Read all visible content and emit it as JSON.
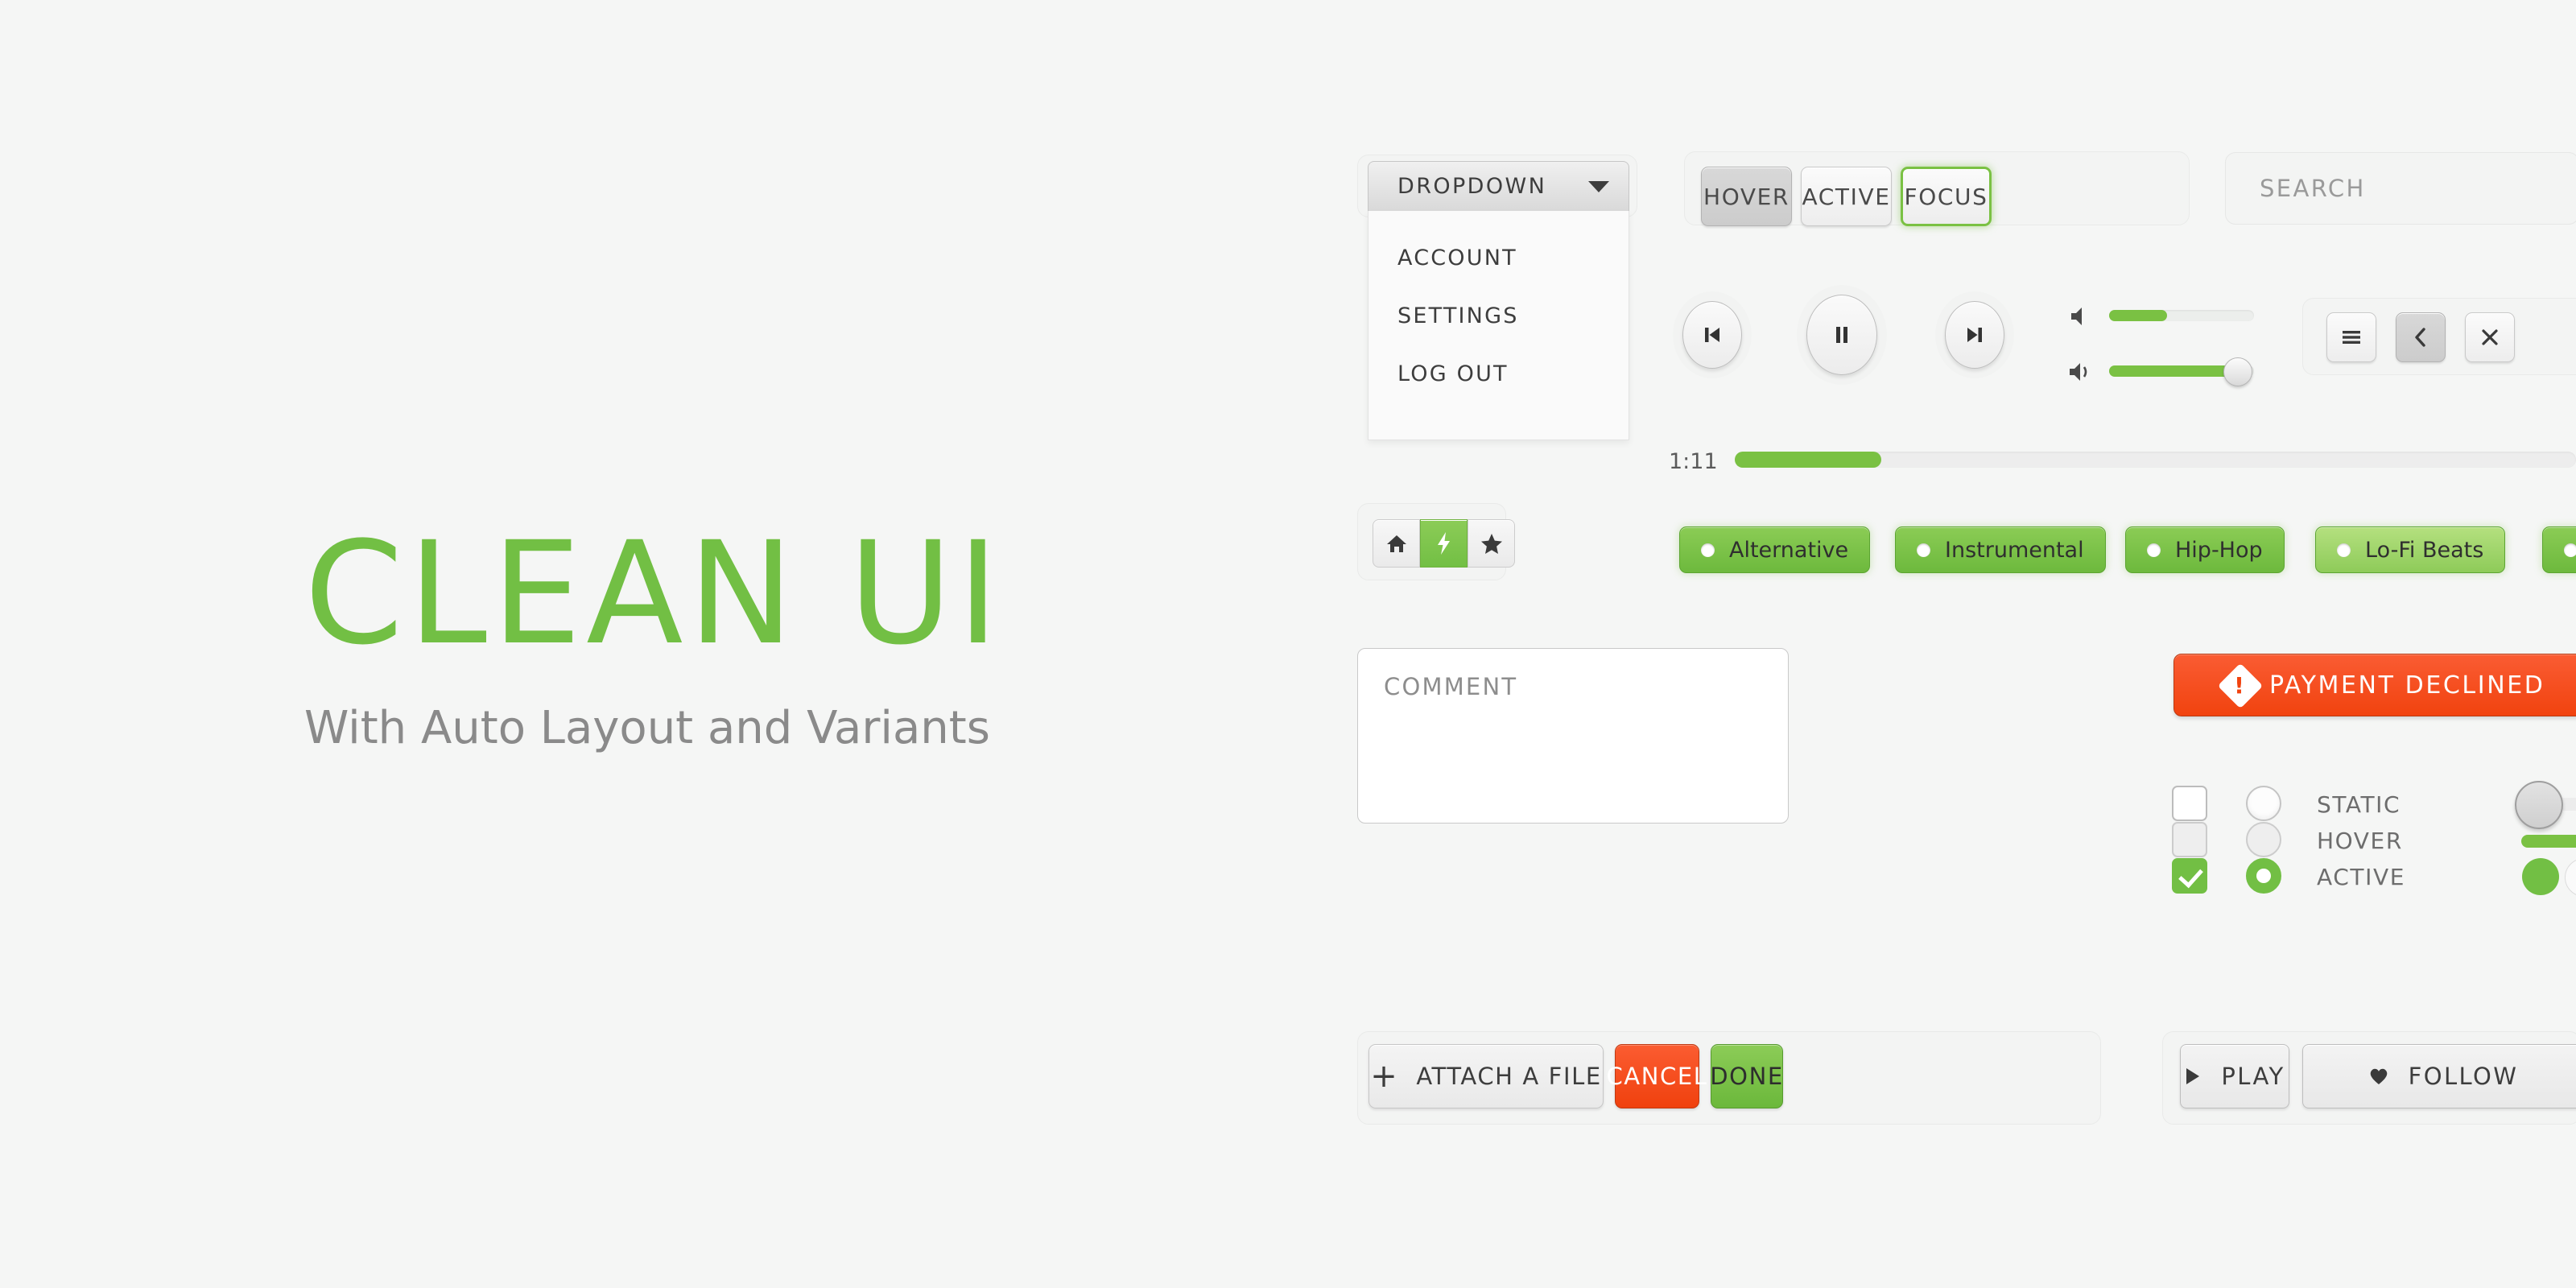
{
  "hero": {
    "title": "CLEAN UI",
    "subtitle": "With Auto Layout and Variants",
    "accent_color": "#72bf44",
    "subtitle_color": "#8a8a8a"
  },
  "dropdown": {
    "label": "DROPDOWN",
    "caret_icon": "chevron-down-icon",
    "items": [
      {
        "label": "ACCOUNT"
      },
      {
        "label": "SETTINGS"
      },
      {
        "label": "LOG OUT"
      }
    ]
  },
  "state_buttons": [
    {
      "label": "HOVER",
      "state": "hover"
    },
    {
      "label": "ACTIVE",
      "state": "active"
    },
    {
      "label": "FOCUS",
      "state": "focus"
    }
  ],
  "search": {
    "placeholder": "SEARCH",
    "value": ""
  },
  "player": {
    "transport": [
      {
        "name": "previous-track-button",
        "icon": "skip-back-icon"
      },
      {
        "name": "play-pause-button",
        "icon": "pause-icon"
      },
      {
        "name": "next-track-button",
        "icon": "skip-forward-icon"
      }
    ],
    "volume_sliders": [
      {
        "name": "volume-slider-low",
        "icon": "speaker-muted-icon",
        "percent": 40
      },
      {
        "name": "volume-slider-high",
        "icon": "speaker-on-icon",
        "percent": 88
      }
    ],
    "progress": {
      "time": "1:11",
      "percent": 17
    }
  },
  "icon_buttons": [
    {
      "name": "menu-button",
      "icon": "hamburger-icon",
      "state": "static"
    },
    {
      "name": "back-button",
      "icon": "chevron-left-icon",
      "state": "hover"
    },
    {
      "name": "close-button",
      "icon": "close-icon",
      "state": "static"
    }
  ],
  "icon_toggle_group": [
    {
      "name": "home-toggle",
      "icon": "home-icon",
      "active": false
    },
    {
      "name": "flash-toggle",
      "icon": "lightning-icon",
      "active": true
    },
    {
      "name": "star-toggle",
      "icon": "star-icon",
      "active": false
    }
  ],
  "tags": [
    {
      "label": "Alternative",
      "variant": "normal"
    },
    {
      "label": "Instrumental",
      "variant": "normal"
    },
    {
      "label": "Hip-Hop",
      "variant": "normal"
    },
    {
      "label": "Lo-Fi Beats",
      "variant": "light"
    },
    {
      "label": "",
      "variant": "normal"
    }
  ],
  "comment": {
    "placeholder": "COMMENT",
    "value": ""
  },
  "alert": {
    "text": "PAYMENT DECLINED",
    "icon": "warning-icon",
    "color": "#f1430f"
  },
  "control_rows": [
    {
      "label": "STATIC",
      "checkbox": "off",
      "radio": "off"
    },
    {
      "label": "HOVER",
      "checkbox": "hov",
      "radio": "hov"
    },
    {
      "label": "ACTIVE",
      "checkbox": "on",
      "radio": "on"
    }
  ],
  "actions": [
    {
      "label": "ATTACH A FILE",
      "icon": "plus-icon",
      "variant": "neutral"
    },
    {
      "label": "CANCEL",
      "variant": "danger"
    },
    {
      "label": "DONE",
      "variant": "success"
    }
  ],
  "media_actions": [
    {
      "label": "PLAY",
      "icon": "play-icon"
    },
    {
      "label": "FOLLOW",
      "icon": "heart-icon"
    }
  ]
}
